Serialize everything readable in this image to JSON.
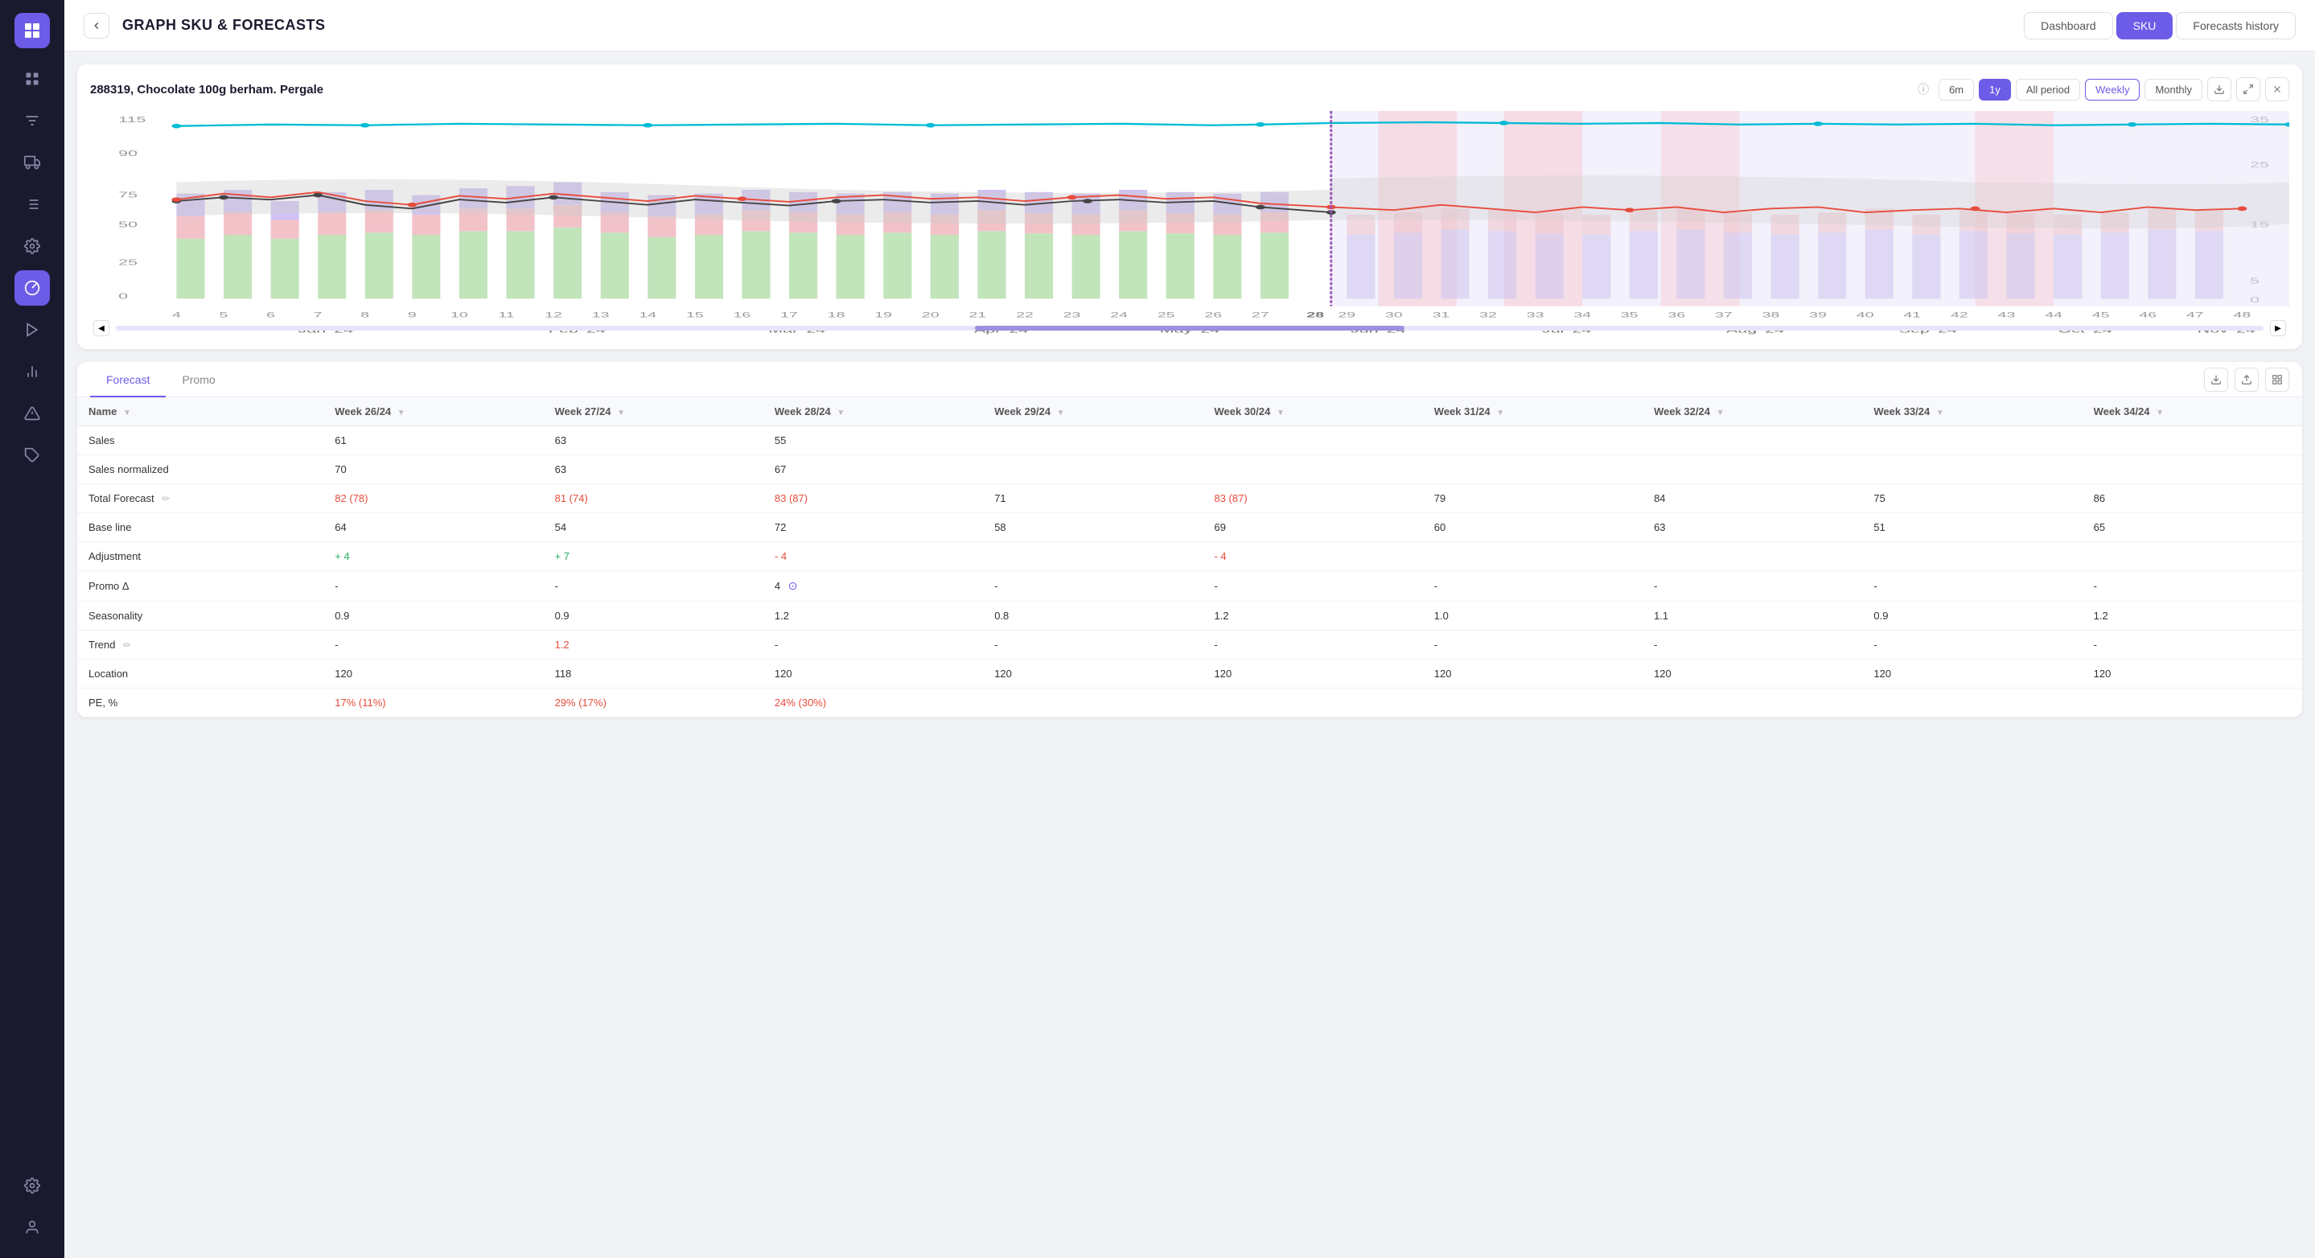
{
  "header": {
    "title": "GRAPH SKU & FORECASTS",
    "nav": {
      "dashboard": "Dashboard",
      "sku": "SKU",
      "forecasts_history": "Forecasts history"
    }
  },
  "chart": {
    "title": "288319, Chocolate 100g berham. Pergale",
    "periods": [
      "6m",
      "1y",
      "All period"
    ],
    "views": [
      "Weekly",
      "Monthly"
    ],
    "active_period": "1y",
    "active_view": "Weekly"
  },
  "table": {
    "tabs": [
      "Forecast",
      "Promo"
    ],
    "active_tab": "Forecast",
    "columns": [
      "Name",
      "Week 26/24",
      "Week 27/24",
      "Week 28/24",
      "Week 29/24",
      "Week 30/24",
      "Week 31/24",
      "Week 32/24",
      "Week 33/24",
      "Week 34/24"
    ],
    "rows": [
      {
        "name": "Sales",
        "values": [
          "61",
          "63",
          "55",
          "",
          "",
          "",
          "",
          "",
          ""
        ]
      },
      {
        "name": "Sales normalized",
        "values": [
          "70",
          "63",
          "67",
          "",
          "",
          "",
          "",
          "",
          ""
        ]
      },
      {
        "name": "Total Forecast",
        "values": [
          "82 (78)",
          "81 (74)",
          "83 (87)",
          "71",
          "83 (87)",
          "79",
          "84",
          "75",
          "86"
        ],
        "red_cols": [
          0,
          1,
          2,
          4
        ]
      },
      {
        "name": "Base line",
        "values": [
          "64",
          "54",
          "72",
          "58",
          "69",
          "60",
          "63",
          "51",
          "65"
        ]
      },
      {
        "name": "Adjustment",
        "values": [
          "+ 4",
          "+ 7",
          "- 4",
          "",
          "- 4",
          "",
          "",
          "",
          ""
        ],
        "red_cols": [
          2,
          4
        ],
        "green_cols": [
          0,
          1
        ]
      },
      {
        "name": "Promo Δ",
        "values": [
          "-",
          "-",
          "4",
          "-",
          "-",
          "-",
          "-",
          "-",
          "-"
        ]
      },
      {
        "name": "Seasonality",
        "values": [
          "0.9",
          "0.9",
          "1.2",
          "0.8",
          "1.2",
          "1.0",
          "1.1",
          "0.9",
          "1.2"
        ]
      },
      {
        "name": "Trend",
        "values": [
          "-",
          "1.2",
          "-",
          "-",
          "-",
          "-",
          "-",
          "-",
          "-"
        ],
        "red_cols": [
          1
        ]
      },
      {
        "name": "Location",
        "values": [
          "120",
          "118",
          "120",
          "120",
          "120",
          "120",
          "120",
          "120",
          "120"
        ]
      },
      {
        "name": "PE, %",
        "values": [
          "17% (11%)",
          "29% (17%)",
          "24% (30%)",
          "",
          "",
          "",
          "",
          "",
          ""
        ],
        "red_cols": [
          0,
          1,
          2
        ]
      }
    ]
  },
  "sidebar": {
    "icons": [
      "grid",
      "filter",
      "truck",
      "list",
      "gear",
      "analytics",
      "play",
      "chart-bar",
      "warning",
      "tag",
      "settings",
      "user"
    ]
  }
}
